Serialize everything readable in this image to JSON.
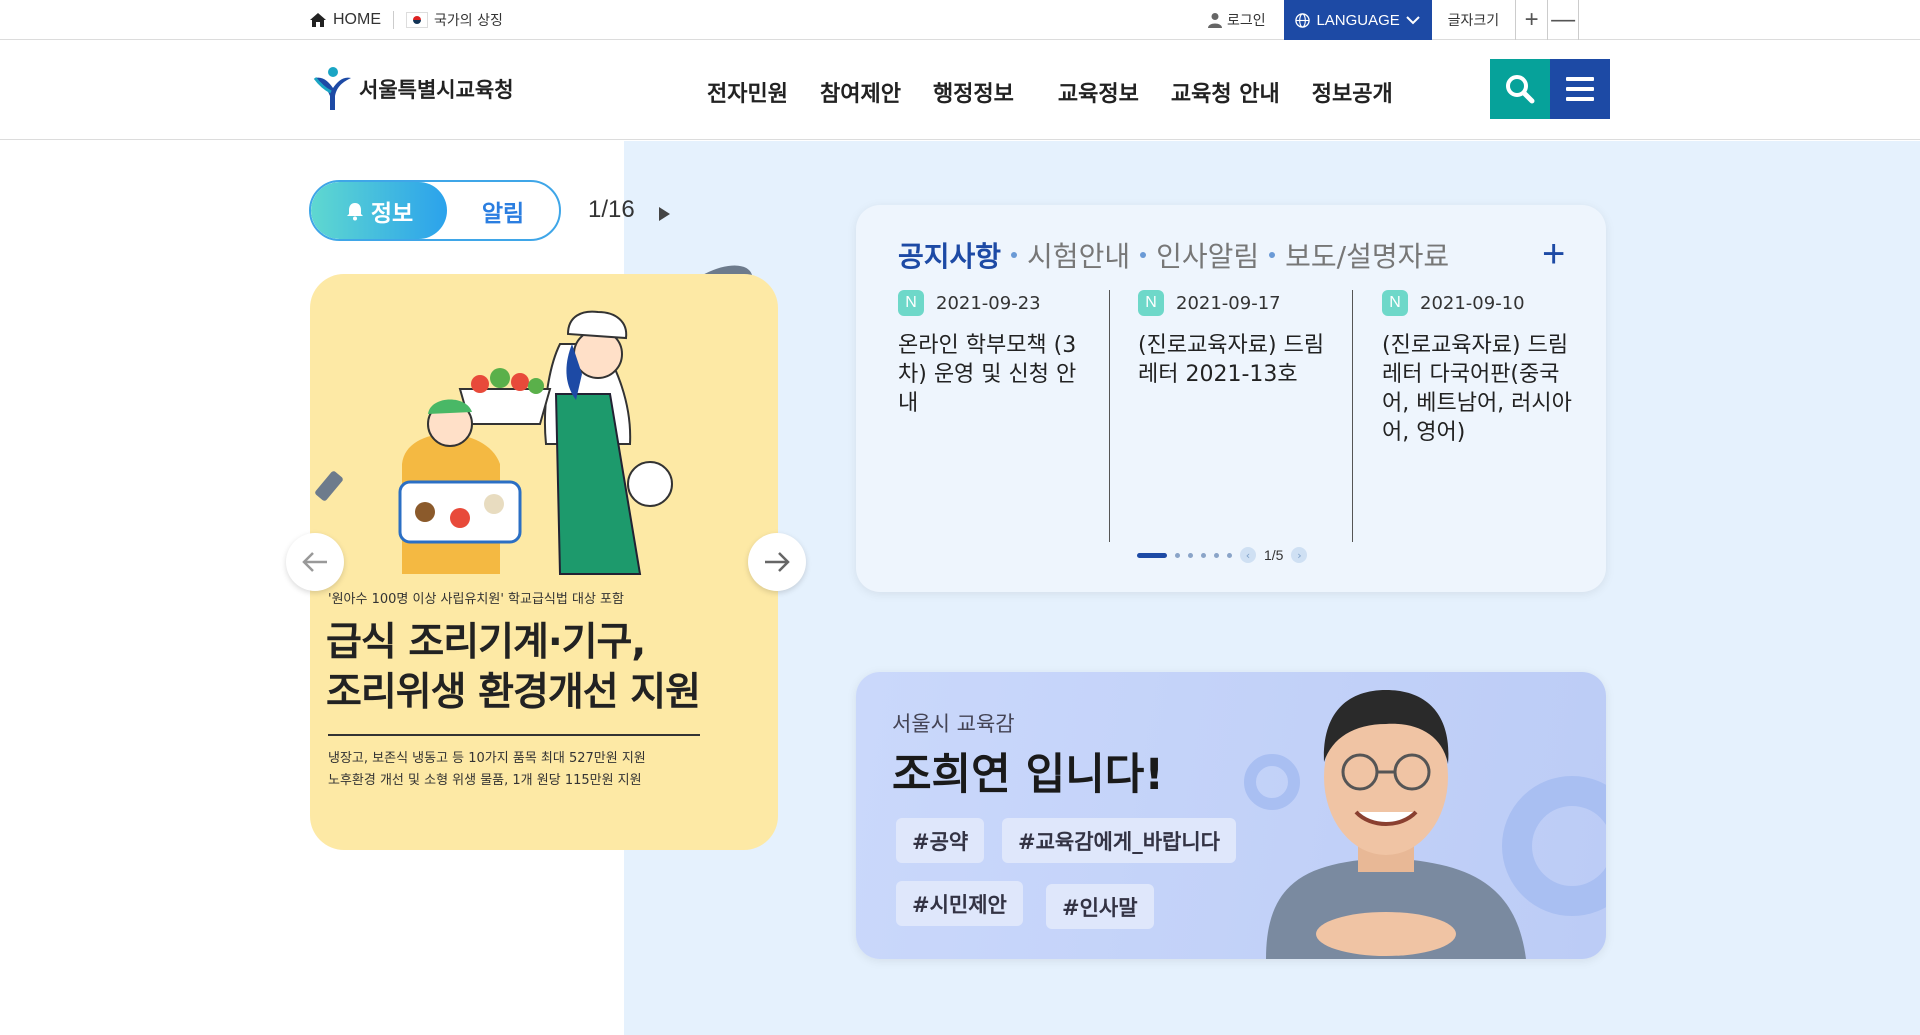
{
  "topbar": {
    "home_label": "HOME",
    "symbol_label": "국가의 상징",
    "login_label": "로그인",
    "language_label": "LANGUAGE",
    "font_size_label": "글자크기",
    "font_plus": "+",
    "font_minus": "—"
  },
  "header": {
    "logo_text": "서울특별시교육청",
    "nav": [
      "전자민원",
      "참여제안",
      "행정정보",
      "교육정보",
      "교육청 안내",
      "정보공개"
    ]
  },
  "slider": {
    "tab_info": "정보",
    "tab_alert": "알림",
    "counter": "1/16",
    "banner": {
      "subtitle": "'원아수 100명 이상 사립유치원' 학교급식법 대상 포함",
      "title_line1": "급식 조리기계·기구,",
      "title_line2": "조리위생 환경개선 지원",
      "desc_line1": "냉장고, 보존식 냉동고 등 10가지 품목 최대 527만원 지원",
      "desc_line2": "노후환경 개선 및 소형 위생 물품, 1개 원당 115만원 지원"
    }
  },
  "notice": {
    "tabs": [
      "공지사항",
      "시험안내",
      "인사알림",
      "보도/설명자료"
    ],
    "more": "+",
    "items": [
      {
        "badge": "N",
        "date": "2021-09-23",
        "title": "온라인 학부모책 (3차) 운영 및 신청 안내"
      },
      {
        "badge": "N",
        "date": "2021-09-17",
        "title": "(진로교육자료) 드림레터 2021-13호"
      },
      {
        "badge": "N",
        "date": "2021-09-10",
        "title": "(진로교육자료) 드림레터 다국어판(중국어, 베트남어, 러시아어, 영어)"
      }
    ],
    "page": "1/5"
  },
  "profile": {
    "subtitle": "서울시 교육감",
    "title": "조희연 입니다!",
    "tags": [
      "#공약",
      "#교육감에게_바랍니다",
      "#시민제안",
      "#인사말"
    ]
  },
  "colors": {
    "primary": "#1d4aa5",
    "teal": "#06a29a",
    "panel_bg": "#e5f1fd",
    "banner_bg": "#fde9a5"
  }
}
